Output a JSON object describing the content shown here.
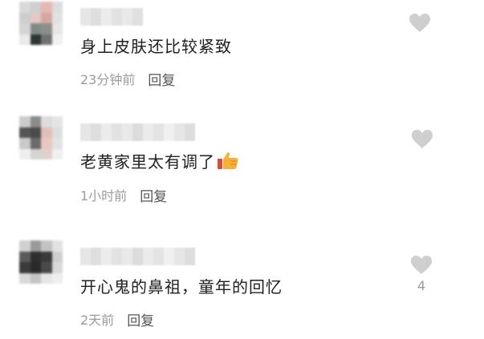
{
  "colors": {
    "text": "#1f1f1f",
    "meta": "#9b9b9b",
    "reply": "#555555",
    "heart": "#cfcfcf",
    "background": "#ffffff"
  },
  "comments": [
    {
      "text": "身上皮肤还比较紧致",
      "time": "23分钟前",
      "reply": "回复",
      "like_icon": "heart-icon",
      "like_count": "",
      "has_emoji": false
    },
    {
      "text": "老黄家里太有调了",
      "time": "1小时前",
      "reply": "回复",
      "like_icon": "heart-icon",
      "like_count": "",
      "has_emoji": true,
      "emoji": "thumbs-up-icon"
    },
    {
      "text": "开心鬼的鼻祖，童年的回忆",
      "time": "2天前",
      "reply": "回复",
      "like_icon": "heart-icon",
      "like_count": "4",
      "has_emoji": false
    }
  ]
}
